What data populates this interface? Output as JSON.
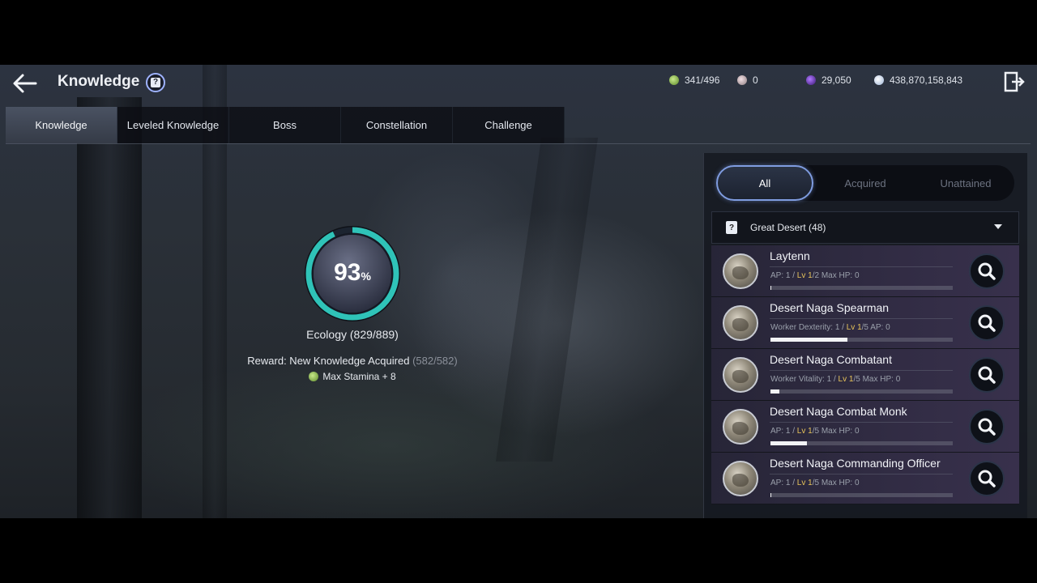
{
  "header": {
    "title": "Knowledge",
    "back_icon": "arrow-left-icon",
    "help_icon": "help-icon",
    "exit_icon": "exit-icon"
  },
  "currencies": [
    {
      "name": "energy",
      "icon": "energy-icon",
      "value": "341/496"
    },
    {
      "name": "pearl",
      "icon": "pearl-icon",
      "value": "0"
    },
    {
      "name": "crystal",
      "icon": "crystal-icon",
      "value": "29,050"
    },
    {
      "name": "silver",
      "icon": "silver-icon",
      "value": "438,870,158,843"
    }
  ],
  "tabs": [
    {
      "label": "Knowledge",
      "active": true
    },
    {
      "label": "Leveled Knowledge",
      "active": false
    },
    {
      "label": "Boss",
      "active": false
    },
    {
      "label": "Constellation",
      "active": false
    },
    {
      "label": "Challenge",
      "active": false
    }
  ],
  "progress": {
    "percent_number": "93",
    "percent_unit": "%",
    "fraction": 0.93,
    "label": "Ecology (829/889)",
    "reward_prefix": "Reward: New Knowledge Acquired ",
    "reward_count": "(582/582)",
    "reward_bonus": "Max Stamina + 8",
    "ring_color": "#2fc3b8"
  },
  "filters": {
    "all": "All",
    "acquired": "Acquired",
    "unattained": "Unattained"
  },
  "region": {
    "label": "Great Desert (48)"
  },
  "entries": [
    {
      "name": "Laytenn",
      "stat_prefix": "AP: 1 / ",
      "lv_label": "Lv",
      "lv": "1",
      "lv_max": "/2",
      "stat_suffix": " Max HP: 0",
      "progress": 0.0
    },
    {
      "name": "Desert Naga Spearman",
      "stat_prefix": "Worker Dexterity: 1 / ",
      "lv_label": "Lv",
      "lv": "1",
      "lv_max": "/5",
      "stat_suffix": " AP: 0",
      "progress": 0.42
    },
    {
      "name": "Desert Naga Combatant",
      "stat_prefix": "Worker Vitality: 1 / ",
      "lv_label": "Lv",
      "lv": "1",
      "lv_max": "/5",
      "stat_suffix": " Max HP: 0",
      "progress": 0.05
    },
    {
      "name": "Desert Naga Combat Monk",
      "stat_prefix": "AP: 1 / ",
      "lv_label": "Lv",
      "lv": "1",
      "lv_max": "/5",
      "stat_suffix": " Max HP: 0",
      "progress": 0.2
    },
    {
      "name": "Desert Naga Commanding Officer",
      "stat_prefix": "AP: 1 / ",
      "lv_label": "Lv",
      "lv": "1",
      "lv_max": "/5",
      "stat_suffix": " Max HP: 0",
      "progress": 0.0
    }
  ]
}
